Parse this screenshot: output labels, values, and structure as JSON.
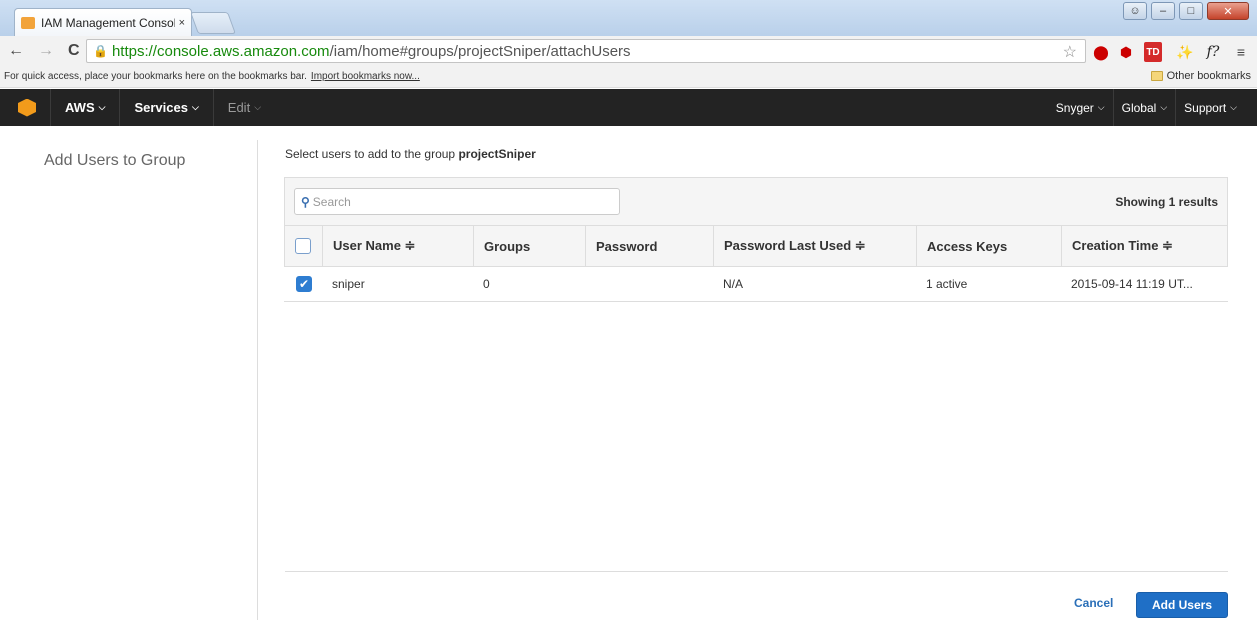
{
  "browser": {
    "tab_title": "IAM Management Consol",
    "tab_close": "×",
    "url_scheme_host": "https://console.aws.amazon.com",
    "url_path": "/iam/home#groups/projectSniper/attachUsers",
    "bookmarks_text": "For quick access, place your bookmarks here on the bookmarks bar.",
    "bookmarks_import": "Import bookmarks now...",
    "other_bookmarks": "Other bookmarks"
  },
  "aws_nav": {
    "aws": "AWS",
    "services": "Services",
    "edit": "Edit",
    "user": "Snyger",
    "region": "Global",
    "support": "Support"
  },
  "sidebar": {
    "title": "Add Users to Group"
  },
  "main": {
    "instruction_prefix": "Select users to add to the group",
    "group_name": "projectSniper",
    "search_placeholder": "Search",
    "results": "Showing 1 results",
    "columns": [
      "User Name ≑",
      "Groups",
      "Password",
      "Password Last Used ≑",
      "Access Keys",
      "Creation Time ≑"
    ],
    "rows": [
      {
        "checked": true,
        "user_name": "sniper",
        "groups": "0",
        "password": "",
        "password_last_used": "N/A",
        "access_keys": "1 active",
        "creation_time": "2015-09-14 11:19 UT..."
      }
    ]
  },
  "footer": {
    "cancel": "Cancel",
    "add_users": "Add Users"
  }
}
